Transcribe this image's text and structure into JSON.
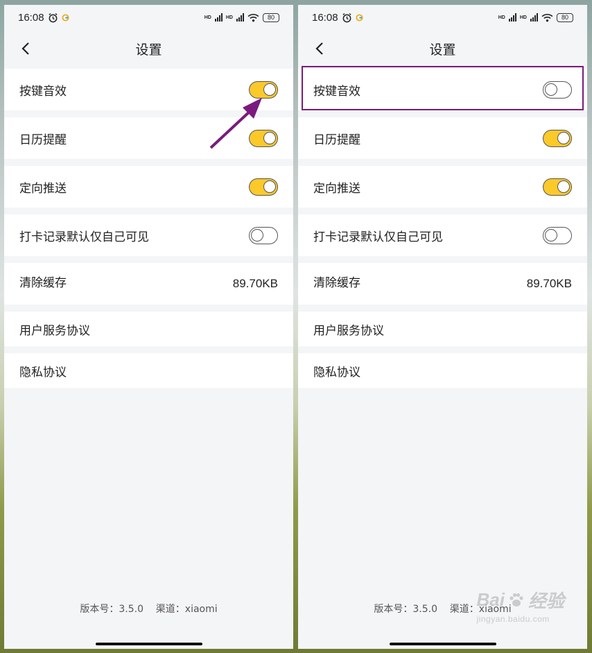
{
  "status_bar": {
    "time": "16:08",
    "hd_label_1": "HD",
    "hd_label_2": "HD",
    "battery": "80",
    "icons": [
      "alarm-icon",
      "gmail-like-circle-icon",
      "signal-icon",
      "wifi-icon",
      "battery-icon"
    ]
  },
  "nav": {
    "title": "设置",
    "back_icon": "chevron-left-icon"
  },
  "screens": [
    {
      "settings": [
        {
          "label": "按键音效",
          "control": "toggle",
          "on": true
        },
        {
          "label": "日历提醒",
          "control": "toggle",
          "on": true
        },
        {
          "label": "定向推送",
          "control": "toggle",
          "on": true
        },
        {
          "label": "打卡记录默认仅自己可见",
          "control": "toggle",
          "on": false
        },
        {
          "label": "清除缓存",
          "value": "89.70KB"
        },
        {
          "label": "用户服务协议"
        },
        {
          "label": "隐私协议"
        }
      ],
      "version_text": "版本号：3.5.0    渠道：xiaomi"
    },
    {
      "settings": [
        {
          "label": "按键音效",
          "control": "toggle",
          "on": false
        },
        {
          "label": "日历提醒",
          "control": "toggle",
          "on": true
        },
        {
          "label": "定向推送",
          "control": "toggle",
          "on": true
        },
        {
          "label": "打卡记录默认仅自己可见",
          "control": "toggle",
          "on": false
        },
        {
          "label": "清除缓存",
          "value": "89.70KB"
        },
        {
          "label": "用户服务协议"
        },
        {
          "label": "隐私协议"
        }
      ],
      "version_text": "版本号：3.5.0    渠道：xiaomi"
    }
  ],
  "annotation": {
    "arrow_color": "#7a1a7e",
    "highlight_color": "#7a1a7e"
  },
  "watermark": {
    "brand": "Bai",
    "brand_cn": "经验",
    "url": "jingyan.baidu.com"
  },
  "colors": {
    "toggle_on": "#fbc92a",
    "background": "#f4f5f7"
  }
}
